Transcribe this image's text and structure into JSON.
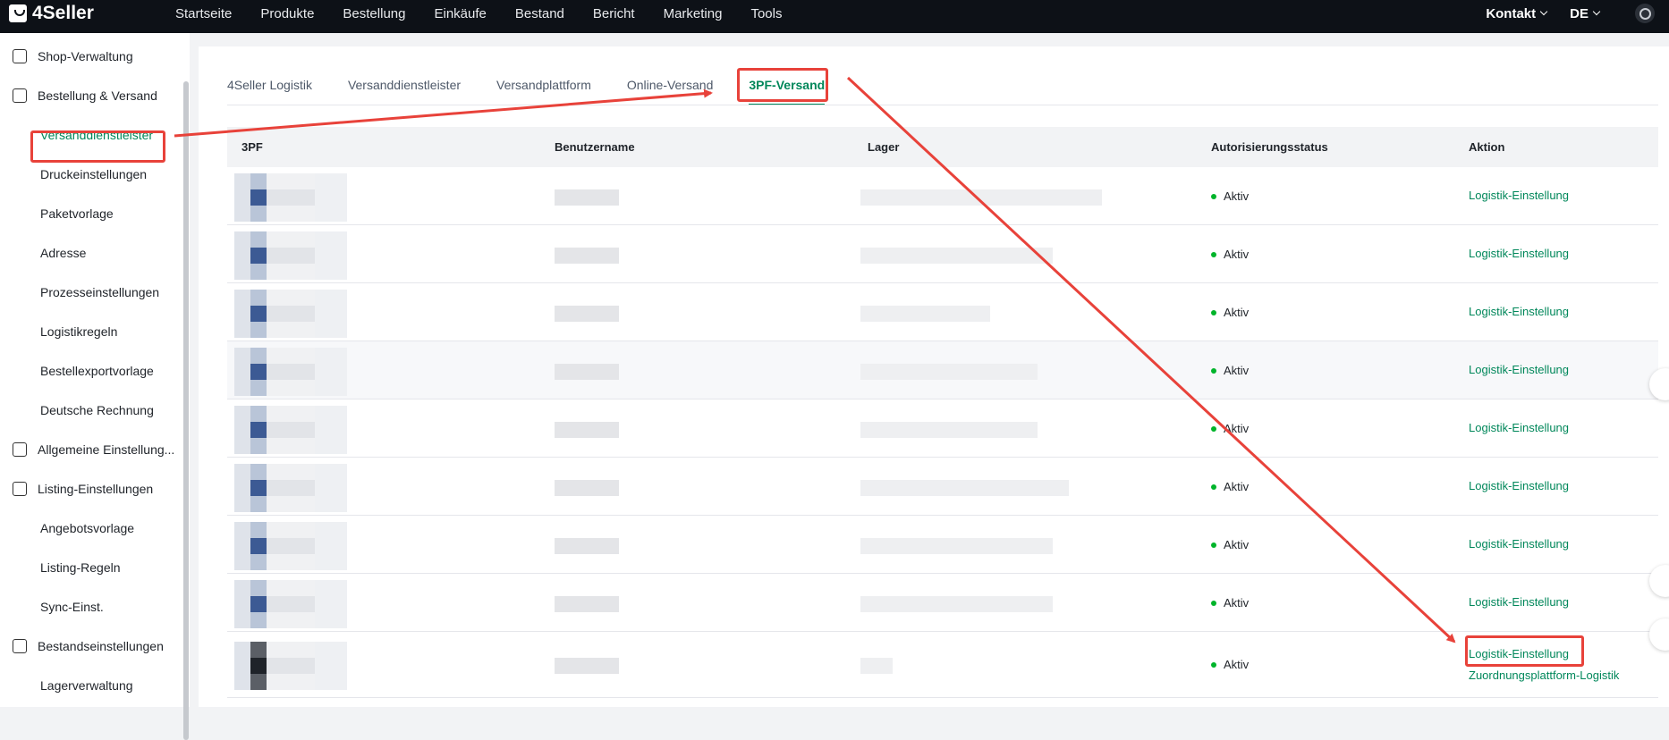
{
  "app": {
    "brand": "4Seller"
  },
  "topnav": [
    "Startseite",
    "Produkte",
    "Bestellung",
    "Einkäufe",
    "Bestand",
    "Bericht",
    "Marketing",
    "Tools"
  ],
  "topright": {
    "contact": "Kontakt",
    "language": "DE"
  },
  "sidebar": {
    "items": [
      {
        "label": "Shop-Verwaltung",
        "type": "group",
        "icon": "shop-icon"
      },
      {
        "label": "Bestellung & Versand",
        "type": "group",
        "icon": "order-icon"
      },
      {
        "label": "Versanddienstleister",
        "type": "sub",
        "active": true
      },
      {
        "label": "Druckeinstellungen",
        "type": "sub"
      },
      {
        "label": "Paketvorlage",
        "type": "sub"
      },
      {
        "label": "Adresse",
        "type": "sub"
      },
      {
        "label": "Prozesseinstellungen",
        "type": "sub"
      },
      {
        "label": "Logistikregeln",
        "type": "sub"
      },
      {
        "label": "Bestellexportvorlage",
        "type": "sub"
      },
      {
        "label": "Deutsche Rechnung",
        "type": "sub"
      },
      {
        "label": "Allgemeine Einstellung...",
        "type": "group",
        "icon": "settings-icon"
      },
      {
        "label": "Listing-Einstellungen",
        "type": "group",
        "icon": "listing-icon"
      },
      {
        "label": "Angebotsvorlage",
        "type": "sub"
      },
      {
        "label": "Listing-Regeln",
        "type": "sub"
      },
      {
        "label": "Sync-Einst.",
        "type": "sub"
      },
      {
        "label": "Bestandseinstellungen",
        "type": "group",
        "icon": "inventory-icon"
      },
      {
        "label": "Lagerverwaltung",
        "type": "sub"
      }
    ]
  },
  "tabs": [
    "4Seller Logistik",
    "Versanddienstleister",
    "Versandplattform",
    "Online-Versand",
    "3PF-Versand"
  ],
  "active_tab": "3PF-Versand",
  "table": {
    "headers": [
      "3PF",
      "Benutzername",
      "Lager",
      "Autorisierungsstatus",
      "Aktion"
    ],
    "rows": [
      {
        "status": "Aktiv",
        "action": "Logistik-Einstellung"
      },
      {
        "status": "Aktiv",
        "action": "Logistik-Einstellung"
      },
      {
        "status": "Aktiv",
        "action": "Logistik-Einstellung"
      },
      {
        "status": "Aktiv",
        "action": "Logistik-Einstellung"
      },
      {
        "status": "Aktiv",
        "action": "Logistik-Einstellung"
      },
      {
        "status": "Aktiv",
        "action": "Logistik-Einstellung"
      },
      {
        "status": "Aktiv",
        "action": "Logistik-Einstellung"
      },
      {
        "status": "Aktiv",
        "action": "Logistik-Einstellung"
      },
      {
        "status": "Aktiv",
        "action": "Logistik-Einstellung",
        "action2": "Zuordnungsplattform-Logistik"
      }
    ]
  },
  "colors": {
    "accent": "#00875a",
    "annotation": "#e8423a",
    "topbar": "#0d1117",
    "status_dot": "#00b42a"
  }
}
